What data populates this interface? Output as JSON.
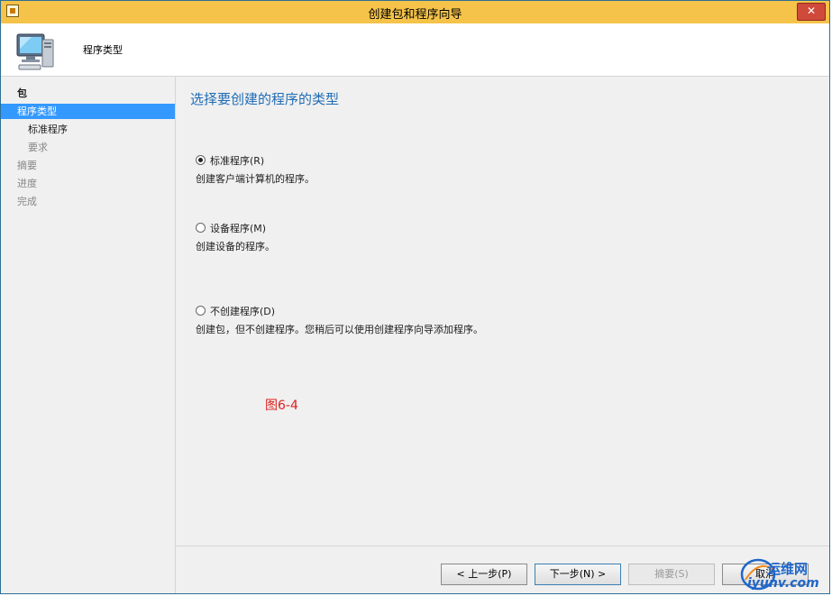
{
  "window": {
    "title": "创建包和程序向导",
    "close_glyph": "✕"
  },
  "header": {
    "title": "程序类型"
  },
  "sidebar": {
    "items": [
      {
        "label": "包"
      },
      {
        "label": "程序类型"
      },
      {
        "label": "标准程序"
      },
      {
        "label": "要求"
      },
      {
        "label": "摘要"
      },
      {
        "label": "进度"
      },
      {
        "label": "完成"
      }
    ]
  },
  "main": {
    "title": "选择要创建的程序的类型",
    "options": [
      {
        "label": "标准程序(R)",
        "description": "创建客户端计算机的程序。",
        "checked": true
      },
      {
        "label": "设备程序(M)",
        "description": "创建设备的程序。",
        "checked": false
      },
      {
        "label": "不创建程序(D)",
        "description": "创建包，但不创建程序。您稍后可以使用创建程序向导添加程序。",
        "checked": false
      }
    ],
    "figure_caption": "图6-4"
  },
  "footer": {
    "prev_label": "< 上一步(P)",
    "next_label": "下一步(N) >",
    "summary_label": "摘要(S)",
    "cancel_label": "取消"
  },
  "watermark": {
    "line1": "运维网",
    "line2": "iyunv.com"
  }
}
